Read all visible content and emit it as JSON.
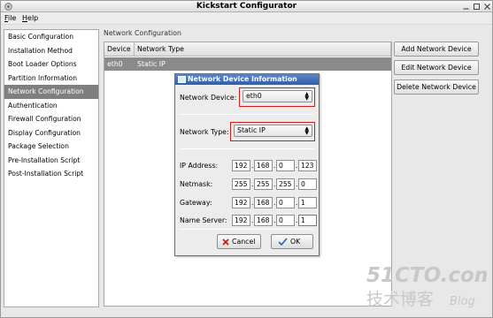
{
  "window": {
    "title": "Kickstart Configurator"
  },
  "menubar": {
    "items": [
      {
        "label": "File"
      },
      {
        "label": "Help"
      }
    ]
  },
  "sidebar": {
    "items": [
      {
        "label": "Basic Configuration"
      },
      {
        "label": "Installation Method"
      },
      {
        "label": "Boot Loader Options"
      },
      {
        "label": "Partition Information"
      },
      {
        "label": "Network Configuration",
        "selected": true
      },
      {
        "label": "Authentication"
      },
      {
        "label": "Firewall Configuration"
      },
      {
        "label": "Display Configuration"
      },
      {
        "label": "Package Selection"
      },
      {
        "label": "Pre-Installation Script"
      },
      {
        "label": "Post-Installation Script"
      }
    ]
  },
  "main": {
    "section_title": "Network Configuration",
    "table": {
      "columns": [
        "Device",
        "Network Type"
      ],
      "rows": [
        {
          "device": "eth0",
          "network_type": "Static IP"
        }
      ]
    },
    "buttons": {
      "add": "Add Network Device",
      "edit": "Edit Network Device",
      "delete": "Delete Network Device"
    }
  },
  "dialog": {
    "title": "Network Device Information",
    "network_device": {
      "label": "Network Device:",
      "value": "eth0"
    },
    "network_type": {
      "label": "Network Type:",
      "value": "Static IP"
    },
    "ip_address": {
      "label": "IP Address:",
      "octets": [
        "192",
        "168",
        "0",
        "123"
      ]
    },
    "netmask": {
      "label": "Netmask:",
      "octets": [
        "255",
        "255",
        "255",
        "0"
      ]
    },
    "gateway": {
      "label": "Gateway:",
      "octets": [
        "192",
        "168",
        "0",
        "1"
      ]
    },
    "name_server": {
      "label": "Name Server:",
      "octets": [
        "192",
        "168",
        "0",
        "1"
      ]
    },
    "cancel_label": "Cancel",
    "ok_label": "OK",
    "highlight_color": "#d41c1c"
  },
  "watermark": {
    "brand": "51CTO.com",
    "chinese": "技术博客",
    "blog": "Blog"
  },
  "colors": {
    "selection": "#7f7f7f",
    "dialog_title": "#2f5fa8"
  }
}
